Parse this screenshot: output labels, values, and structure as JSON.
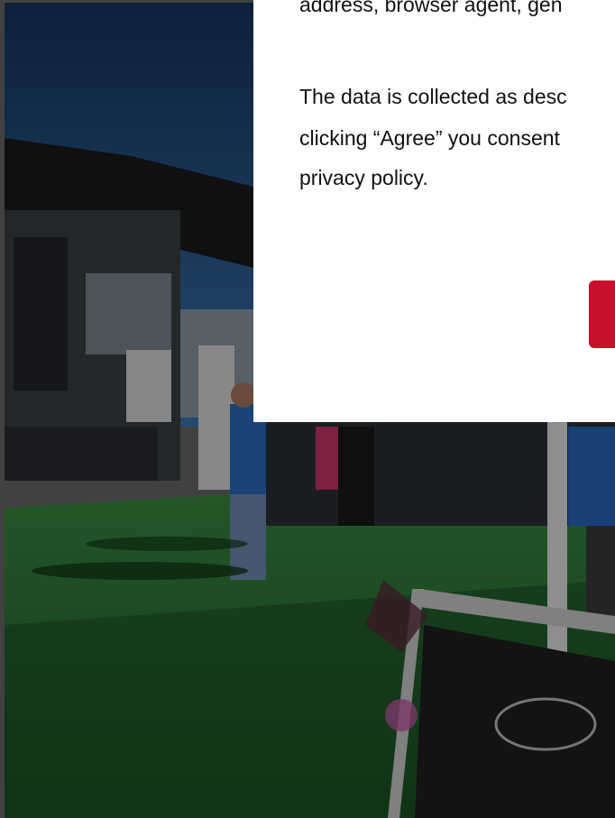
{
  "modal": {
    "lines": [
      "address, browser agent, gen",
      "The data is collected as desc",
      "clicking “Agree” you consent",
      "privacy policy."
    ],
    "agree_label": ""
  },
  "colors": {
    "accent": "#c8102e",
    "turf": "#2f7a36",
    "sky": "#2c5e9c"
  }
}
